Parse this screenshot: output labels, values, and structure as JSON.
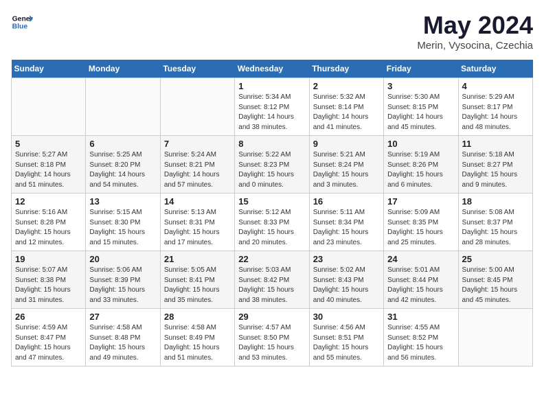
{
  "header": {
    "logo_line1": "General",
    "logo_line2": "Blue",
    "month": "May 2024",
    "location": "Merin, Vysocina, Czechia"
  },
  "weekdays": [
    "Sunday",
    "Monday",
    "Tuesday",
    "Wednesday",
    "Thursday",
    "Friday",
    "Saturday"
  ],
  "weeks": [
    [
      {
        "num": "",
        "info": ""
      },
      {
        "num": "",
        "info": ""
      },
      {
        "num": "",
        "info": ""
      },
      {
        "num": "1",
        "info": "Sunrise: 5:34 AM\nSunset: 8:12 PM\nDaylight: 14 hours\nand 38 minutes."
      },
      {
        "num": "2",
        "info": "Sunrise: 5:32 AM\nSunset: 8:14 PM\nDaylight: 14 hours\nand 41 minutes."
      },
      {
        "num": "3",
        "info": "Sunrise: 5:30 AM\nSunset: 8:15 PM\nDaylight: 14 hours\nand 45 minutes."
      },
      {
        "num": "4",
        "info": "Sunrise: 5:29 AM\nSunset: 8:17 PM\nDaylight: 14 hours\nand 48 minutes."
      }
    ],
    [
      {
        "num": "5",
        "info": "Sunrise: 5:27 AM\nSunset: 8:18 PM\nDaylight: 14 hours\nand 51 minutes."
      },
      {
        "num": "6",
        "info": "Sunrise: 5:25 AM\nSunset: 8:20 PM\nDaylight: 14 hours\nand 54 minutes."
      },
      {
        "num": "7",
        "info": "Sunrise: 5:24 AM\nSunset: 8:21 PM\nDaylight: 14 hours\nand 57 minutes."
      },
      {
        "num": "8",
        "info": "Sunrise: 5:22 AM\nSunset: 8:23 PM\nDaylight: 15 hours\nand 0 minutes."
      },
      {
        "num": "9",
        "info": "Sunrise: 5:21 AM\nSunset: 8:24 PM\nDaylight: 15 hours\nand 3 minutes."
      },
      {
        "num": "10",
        "info": "Sunrise: 5:19 AM\nSunset: 8:26 PM\nDaylight: 15 hours\nand 6 minutes."
      },
      {
        "num": "11",
        "info": "Sunrise: 5:18 AM\nSunset: 8:27 PM\nDaylight: 15 hours\nand 9 minutes."
      }
    ],
    [
      {
        "num": "12",
        "info": "Sunrise: 5:16 AM\nSunset: 8:28 PM\nDaylight: 15 hours\nand 12 minutes."
      },
      {
        "num": "13",
        "info": "Sunrise: 5:15 AM\nSunset: 8:30 PM\nDaylight: 15 hours\nand 15 minutes."
      },
      {
        "num": "14",
        "info": "Sunrise: 5:13 AM\nSunset: 8:31 PM\nDaylight: 15 hours\nand 17 minutes."
      },
      {
        "num": "15",
        "info": "Sunrise: 5:12 AM\nSunset: 8:33 PM\nDaylight: 15 hours\nand 20 minutes."
      },
      {
        "num": "16",
        "info": "Sunrise: 5:11 AM\nSunset: 8:34 PM\nDaylight: 15 hours\nand 23 minutes."
      },
      {
        "num": "17",
        "info": "Sunrise: 5:09 AM\nSunset: 8:35 PM\nDaylight: 15 hours\nand 25 minutes."
      },
      {
        "num": "18",
        "info": "Sunrise: 5:08 AM\nSunset: 8:37 PM\nDaylight: 15 hours\nand 28 minutes."
      }
    ],
    [
      {
        "num": "19",
        "info": "Sunrise: 5:07 AM\nSunset: 8:38 PM\nDaylight: 15 hours\nand 31 minutes."
      },
      {
        "num": "20",
        "info": "Sunrise: 5:06 AM\nSunset: 8:39 PM\nDaylight: 15 hours\nand 33 minutes."
      },
      {
        "num": "21",
        "info": "Sunrise: 5:05 AM\nSunset: 8:41 PM\nDaylight: 15 hours\nand 35 minutes."
      },
      {
        "num": "22",
        "info": "Sunrise: 5:03 AM\nSunset: 8:42 PM\nDaylight: 15 hours\nand 38 minutes."
      },
      {
        "num": "23",
        "info": "Sunrise: 5:02 AM\nSunset: 8:43 PM\nDaylight: 15 hours\nand 40 minutes."
      },
      {
        "num": "24",
        "info": "Sunrise: 5:01 AM\nSunset: 8:44 PM\nDaylight: 15 hours\nand 42 minutes."
      },
      {
        "num": "25",
        "info": "Sunrise: 5:00 AM\nSunset: 8:45 PM\nDaylight: 15 hours\nand 45 minutes."
      }
    ],
    [
      {
        "num": "26",
        "info": "Sunrise: 4:59 AM\nSunset: 8:47 PM\nDaylight: 15 hours\nand 47 minutes."
      },
      {
        "num": "27",
        "info": "Sunrise: 4:58 AM\nSunset: 8:48 PM\nDaylight: 15 hours\nand 49 minutes."
      },
      {
        "num": "28",
        "info": "Sunrise: 4:58 AM\nSunset: 8:49 PM\nDaylight: 15 hours\nand 51 minutes."
      },
      {
        "num": "29",
        "info": "Sunrise: 4:57 AM\nSunset: 8:50 PM\nDaylight: 15 hours\nand 53 minutes."
      },
      {
        "num": "30",
        "info": "Sunrise: 4:56 AM\nSunset: 8:51 PM\nDaylight: 15 hours\nand 55 minutes."
      },
      {
        "num": "31",
        "info": "Sunrise: 4:55 AM\nSunset: 8:52 PM\nDaylight: 15 hours\nand 56 minutes."
      },
      {
        "num": "",
        "info": ""
      }
    ]
  ]
}
